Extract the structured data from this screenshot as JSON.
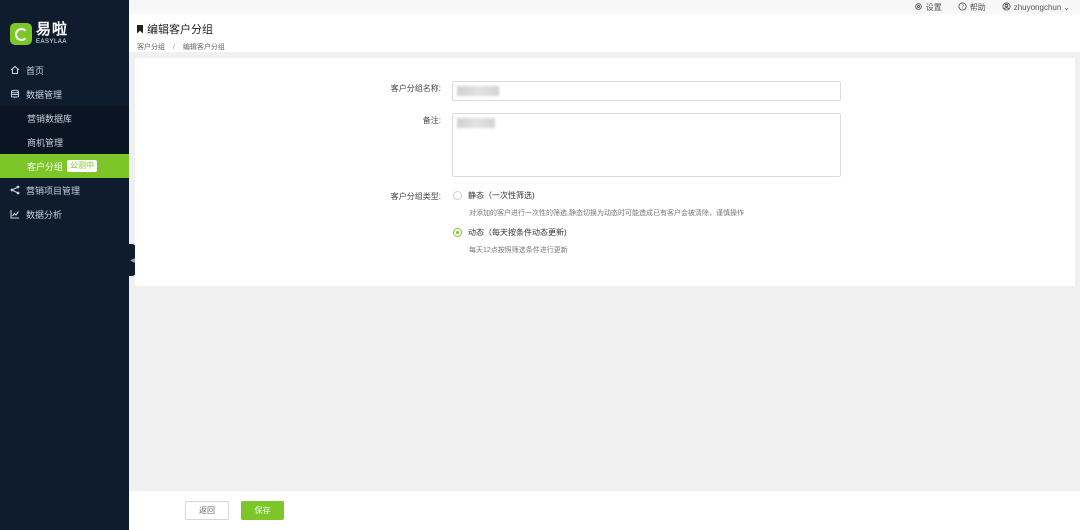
{
  "brand": {
    "name_cn": "易啦",
    "name_en": "EASYLAA"
  },
  "topbar": {
    "settings": "设置",
    "help": "帮助",
    "user": "zhuyongchun"
  },
  "sidebar": {
    "home": "首页",
    "data_mgmt": "数据管理",
    "sub": {
      "marketing_db": "营销数据库",
      "opportunity": "商机管理",
      "customer_group": "客户分组",
      "badge": "公测中"
    },
    "marketing_project": "营销项目管理",
    "data_analysis": "数据分析"
  },
  "header": {
    "title": "编辑客户分组",
    "breadcrumb": [
      "客户分组",
      "编辑客户分组"
    ]
  },
  "form": {
    "name_label": "客户分组名称:",
    "remark_label": "备注:",
    "type_label": "客户分组类型:",
    "static_option": "静态（一次性筛选)",
    "static_hint": "对添加的客户进行一次性的筛选,静态切换为动态时可能造成已有客户会被清除，谨慎操作",
    "dynamic_option": "动态（每天按条件动态更新)",
    "dynamic_hint": "每天12点按照筛选条件进行更新",
    "selected_type": "dynamic"
  },
  "footer": {
    "back": "返回",
    "save": "保存"
  },
  "colors": {
    "accent": "#7cc62a",
    "sidebar_bg": "#0f1c2d"
  }
}
